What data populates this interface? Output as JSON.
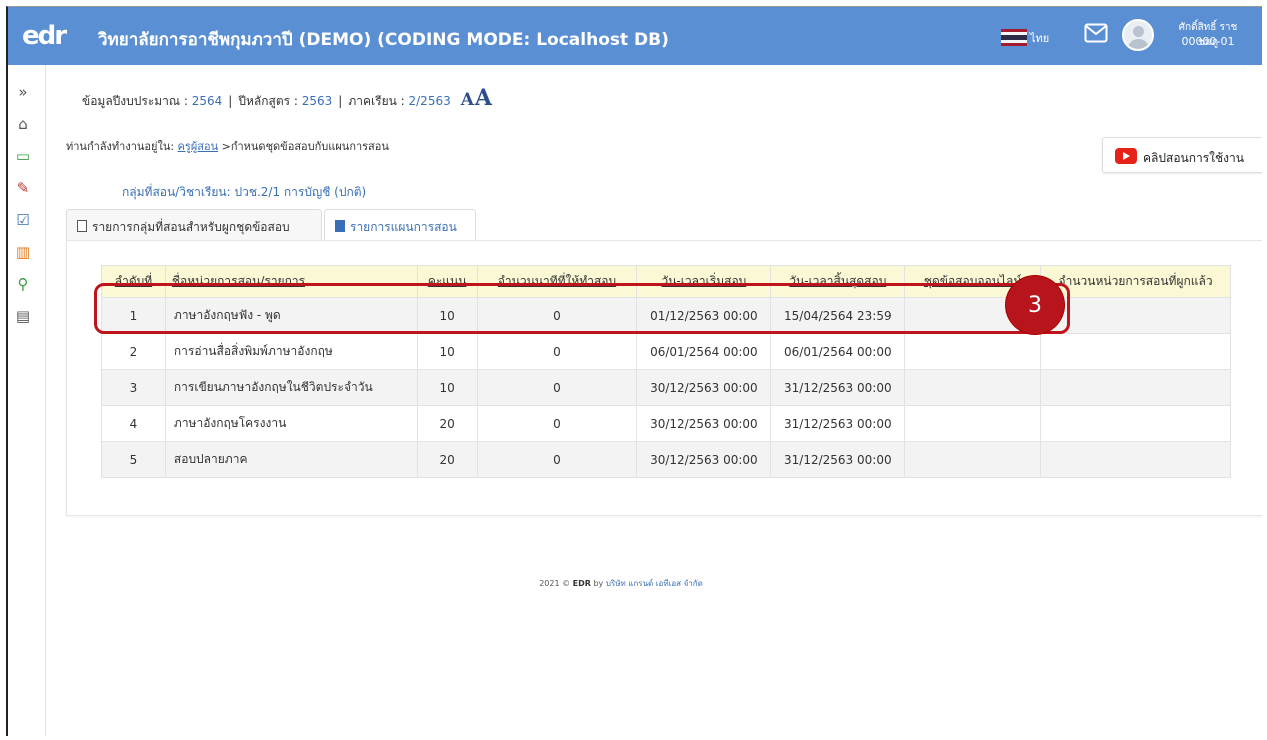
{
  "header": {
    "logo": "edr",
    "title": "วิทยาลัยการอาชีพกุมภวาปี (DEMO) (CODING MODE: Localhost DB)",
    "language": "ไทย",
    "user_name": "ศักดิ์สิทธิ์ ราชชมภู",
    "user_id": "00000-01",
    "flag_colors": [
      "#a51931",
      "#f4f5f8",
      "#2d2a4a",
      "#f4f5f8",
      "#a51931"
    ]
  },
  "sidebar": {
    "items": [
      {
        "icon": "expand-icon",
        "glyph": "»",
        "color": "#555555"
      },
      {
        "icon": "home-icon",
        "glyph": "⌂",
        "color": "#555555"
      },
      {
        "icon": "monitor-icon",
        "glyph": "▭",
        "color": "#3b9a3b"
      },
      {
        "icon": "pencil-icon",
        "glyph": "✎",
        "color": "#c0392b"
      },
      {
        "icon": "checkbox-icon",
        "glyph": "☑",
        "color": "#3a6fb7"
      },
      {
        "icon": "books-icon",
        "glyph": "▥",
        "color": "#e67e22"
      },
      {
        "icon": "user-icon",
        "glyph": "⚲",
        "color": "#3b9a3b"
      },
      {
        "icon": "inbox-icon",
        "glyph": "▤",
        "color": "#555555"
      }
    ]
  },
  "info": {
    "budget_label": "ข้อมูลปีงบประมาณ :",
    "budget_value": "2564",
    "curriculum_label": "ปีหลักสูตร :",
    "curriculum_value": "2563",
    "semester_label": "ภาคเรียน :",
    "semester_value": "2/2563",
    "font_small": "A",
    "font_large": "A"
  },
  "breadcrumb": {
    "prefix": "ท่านกำลังทำงานอยู่ใน:",
    "link": "ครูผู้สอน",
    "current": ">กำหนดชุดข้อสอบกับแผนการสอน"
  },
  "video_button": {
    "label": "คลิปสอนการใช้งาน"
  },
  "group_line": "กลุ่มที่สอน/วิชาเรียน: ปวช.2/1 การบัญชี (ปกติ)",
  "tabs": [
    {
      "label": "รายการกลุ่มที่สอนสำหรับผูกชุดข้อสอบ"
    },
    {
      "label": "รายการแผนการสอน"
    }
  ],
  "table": {
    "headers": [
      "ลำดับที่",
      "ชื่อหน่วยการสอน/รายการ",
      "คะแนน",
      "จำนวนนาทีที่ให้ทำสอบ",
      "วัน-เวลาเริ่มสอบ",
      "วัน-เวลาสิ้นสุดสอบ",
      "ชุดข้อสอบออนไลน์",
      "จำนวนหน่วยการสอนที่ผูกแล้ว"
    ],
    "rows": [
      {
        "no": "1",
        "name": "ภาษาอังกฤษฟัง - พูด",
        "score": "10",
        "minutes": "0",
        "start": "01/12/2563 00:00",
        "end": "15/04/2564 23:59",
        "exam": "",
        "bound": ""
      },
      {
        "no": "2",
        "name": "การอ่านสื่อสิ่งพิมพ์ภาษาอังกฤษ",
        "score": "10",
        "minutes": "0",
        "start": "06/01/2564 00:00",
        "end": "06/01/2564 00:00",
        "exam": "",
        "bound": ""
      },
      {
        "no": "3",
        "name": "การเขียนภาษาอังกฤษในชีวิตประจำวัน",
        "score": "10",
        "minutes": "0",
        "start": "30/12/2563 00:00",
        "end": "31/12/2563 00:00",
        "exam": "",
        "bound": ""
      },
      {
        "no": "4",
        "name": "ภาษาอังกฤษโครงงาน",
        "score": "20",
        "minutes": "0",
        "start": "30/12/2563 00:00",
        "end": "31/12/2563 00:00",
        "exam": "",
        "bound": ""
      },
      {
        "no": "5",
        "name": "สอบปลายภาค",
        "score": "20",
        "minutes": "0",
        "start": "30/12/2563 00:00",
        "end": "31/12/2563 00:00",
        "exam": "",
        "bound": ""
      }
    ]
  },
  "annotation": {
    "step": "3",
    "color": "#c0141c"
  },
  "footer": {
    "year": "2021 ©",
    "brand": "EDR",
    "by": "by",
    "company": "บริษัท แกรนด์ เอทีเอส จำกัด"
  }
}
